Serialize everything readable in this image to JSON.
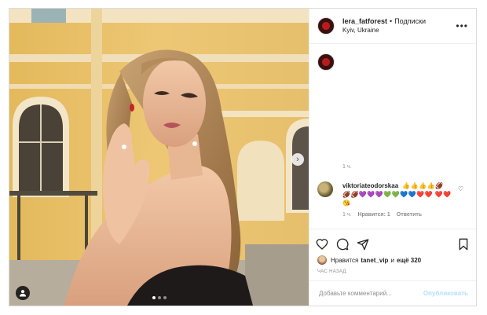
{
  "post": {
    "username": "lera_fatforest",
    "separator": "•",
    "follow_state": "Подписки",
    "location": "Kyiv, Ukraine",
    "more_icon": "more-horizontal-icon",
    "caption_time": "1 ч.",
    "carousel": {
      "slide_count": 3,
      "active_slide": 1
    }
  },
  "comment": {
    "username": "viktoriateodorskaa",
    "text": "👍👍👍👍🏈 🏈🏈💜💜💜💚💚💙💙❤️❤️ ❤️❤️😘",
    "time": "1 ч.",
    "likes": "Нравится: 1",
    "reply": "Ответить"
  },
  "likes": {
    "prefix": "Нравится",
    "user": "tanet_vip",
    "and": "и",
    "others": "ещё 320"
  },
  "post_time": "ЧАС НАЗАД",
  "comment_input": {
    "placeholder": "Добавьте комментарий...",
    "publish": "Опубликовать"
  },
  "colors": {
    "border": "#dbdbdb",
    "muted": "#8e8e8e",
    "publish_disabled": "#b2dffc",
    "wall": "#e9c46a"
  }
}
